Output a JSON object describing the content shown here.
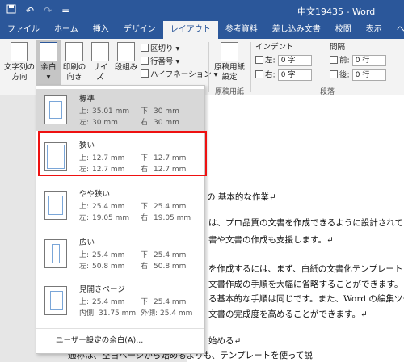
{
  "titlebar": {
    "title": "中文19435 - Word",
    "undo": "↶",
    "redo": "↷",
    "qat_more": "="
  },
  "tabs": [
    "ファイル",
    "ホーム",
    "挿入",
    "デザイン",
    "レイアウト",
    "参考資料",
    "差し込み文書",
    "校閲",
    "表示",
    "ヘルプ"
  ],
  "ribbon": {
    "text_direction": "文字列の\n方向",
    "margins": "余白",
    "orientation": "印刷の\n向き",
    "size": "サイズ",
    "columns": "段組み",
    "breaks": "区切り",
    "line_numbers": "行番号",
    "hyphenation": "ハイフネーション",
    "genko": "原稿用紙\n設定",
    "genko_group": "原稿用紙",
    "indent_label": "インデント",
    "spacing_label": "間隔",
    "indent_left": "左:",
    "indent_right": "右:",
    "indent_left_val": "0 字",
    "indent_right_val": "0 字",
    "space_before": "前:",
    "space_after": "後:",
    "space_before_val": "0 行",
    "space_after_val": "0 行",
    "paragraph_group": "段落"
  },
  "margins_menu": {
    "items": [
      {
        "name": "標準",
        "r1": [
          "上:",
          "35.01 mm",
          "下:",
          "30 mm"
        ],
        "r2": [
          "左:",
          "30 mm",
          "右:",
          "30 mm"
        ]
      },
      {
        "name": "狭い",
        "r1": [
          "上:",
          "12.7 mm",
          "下:",
          "12.7 mm"
        ],
        "r2": [
          "左:",
          "12.7 mm",
          "右:",
          "12.7 mm"
        ]
      },
      {
        "name": "やや狭い",
        "r1": [
          "上:",
          "25.4 mm",
          "下:",
          "25.4 mm"
        ],
        "r2": [
          "左:",
          "19.05 mm",
          "右:",
          "19.05 mm"
        ]
      },
      {
        "name": "広い",
        "r1": [
          "上:",
          "25.4 mm",
          "下:",
          "25.4 mm"
        ],
        "r2": [
          "左:",
          "50.8 mm",
          "右:",
          "50.8 mm"
        ]
      },
      {
        "name": "見開きページ",
        "r1": [
          "上:",
          "25.4 mm",
          "下:",
          "25.4 mm"
        ],
        "r2": [
          "内側:",
          "31.75 mm",
          "外側:",
          "25.4 mm"
        ]
      }
    ],
    "custom": "ユーザー設定の余白(A)..."
  },
  "document": {
    "lines": [
      "の 基本的な作業↵",
      "は、プロ品質の文書を作成できるように設計されてい",
      "書や文書の作成も支援します。↵",
      "を作成するには、まず、白紙の文書化テンプレート",
      "文書作成の手順を大幅に省略することができます。そ",
      "る基本的な手順は同じです。また、Word の編集ツー",
      "文書の完成度を高めることができます。↵",
      "始める↵",
      "通称は、空白ページから始めるよりも、テンプレートを使って説"
    ]
  }
}
